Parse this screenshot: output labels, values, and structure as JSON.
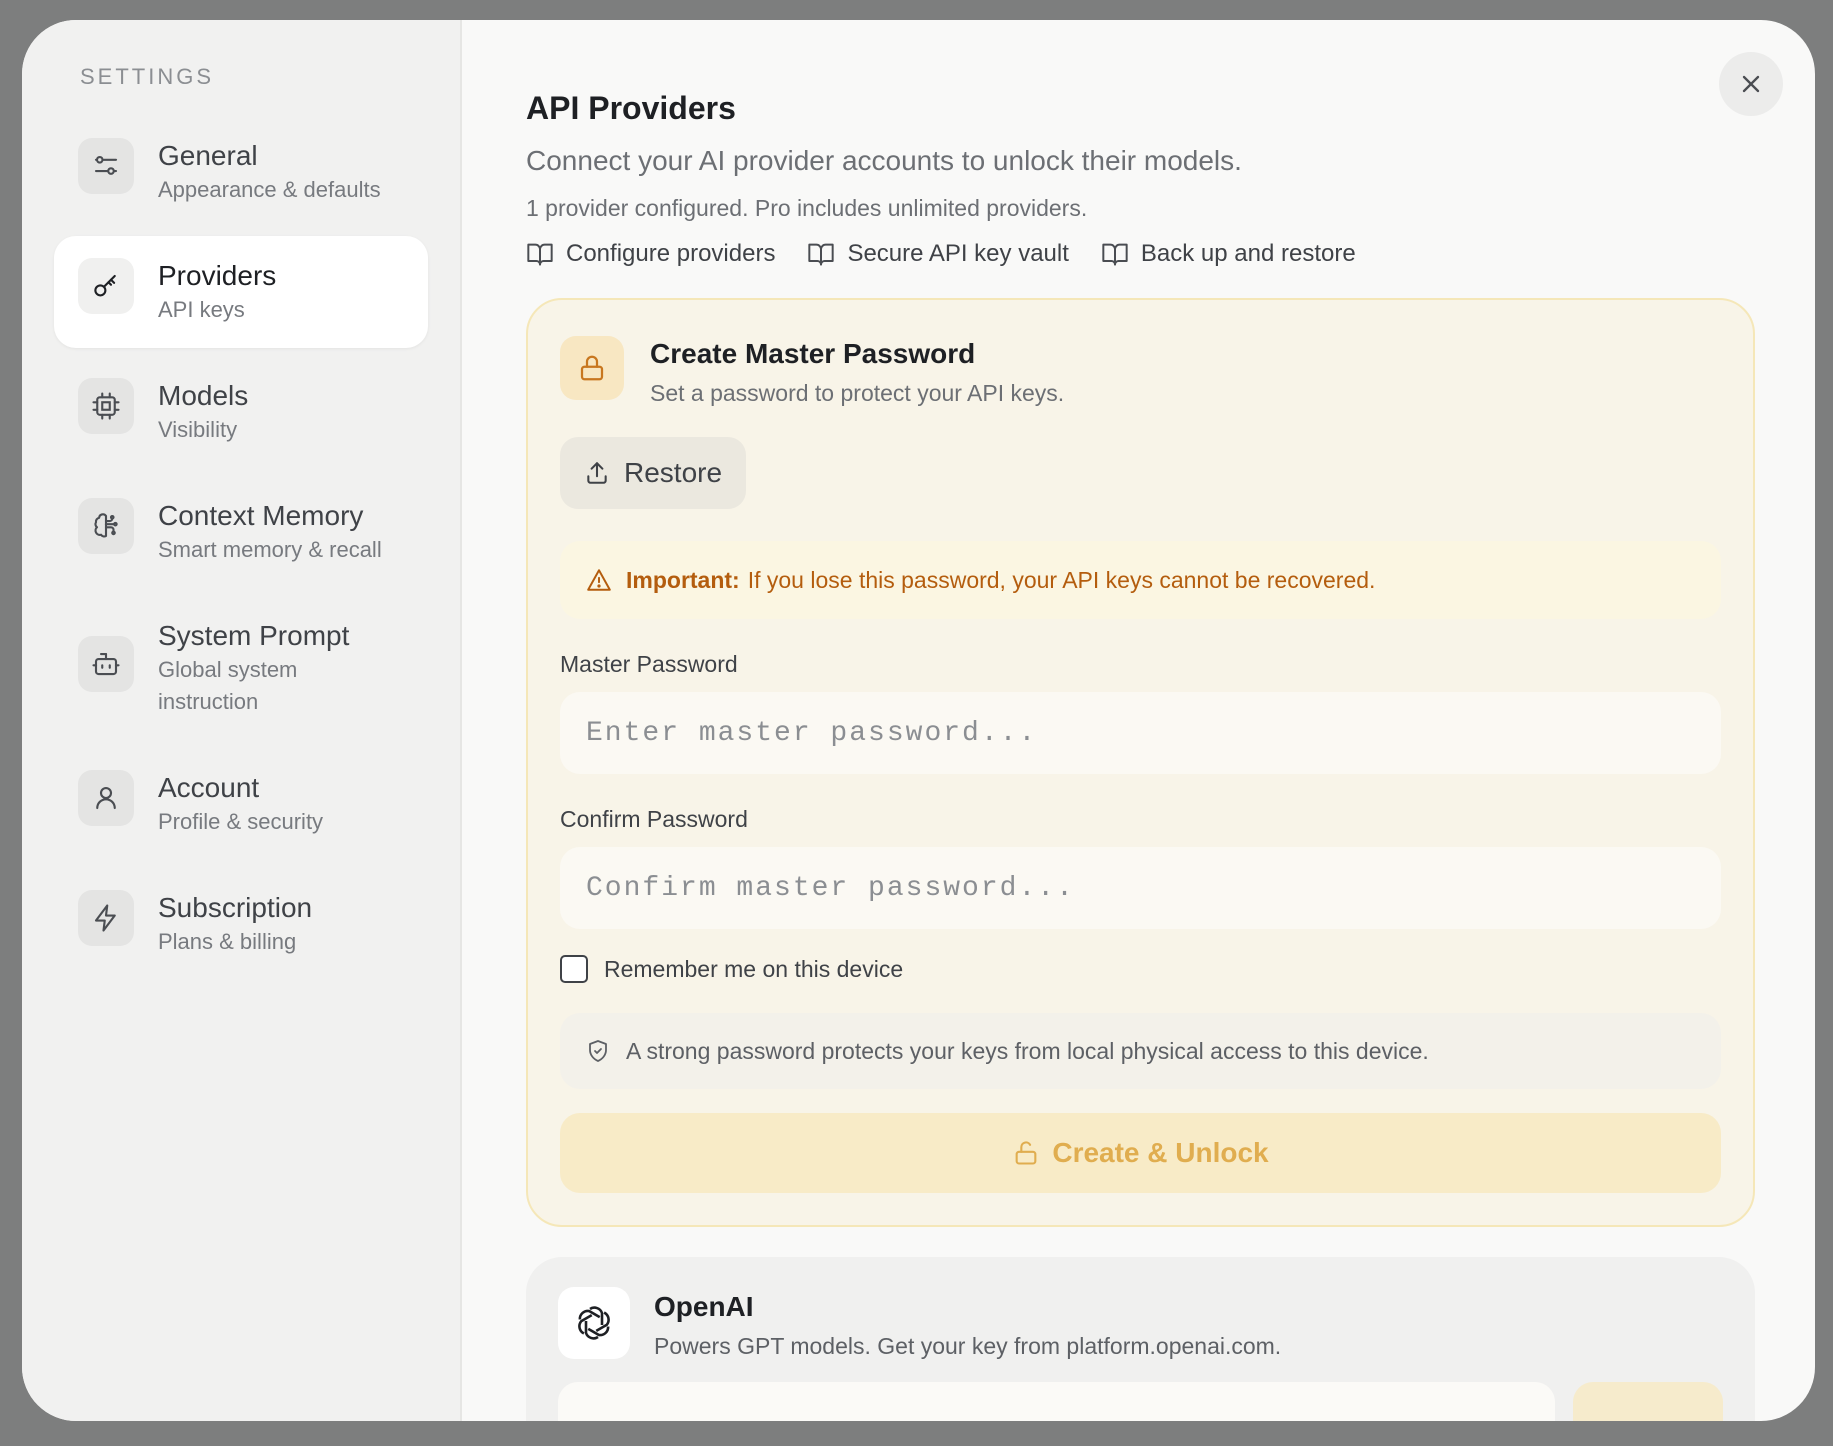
{
  "sidebar": {
    "heading": "SETTINGS",
    "items": [
      {
        "title": "General",
        "subtitle": "Appearance & defaults",
        "icon": "sliders-icon"
      },
      {
        "title": "Providers",
        "subtitle": "API keys",
        "icon": "key-icon",
        "active": true
      },
      {
        "title": "Models",
        "subtitle": "Visibility",
        "icon": "cpu-icon"
      },
      {
        "title": "Context Memory",
        "subtitle": "Smart memory & recall",
        "icon": "brain-icon"
      },
      {
        "title": "System Prompt",
        "subtitle": "Global system instruction",
        "icon": "bot-icon"
      },
      {
        "title": "Account",
        "subtitle": "Profile & security",
        "icon": "user-icon"
      },
      {
        "title": "Subscription",
        "subtitle": "Plans & billing",
        "icon": "bolt-icon"
      }
    ]
  },
  "main": {
    "title": "API Providers",
    "subtitle": "Connect your AI provider accounts to unlock their models.",
    "meta": "1 provider configured. Pro includes unlimited providers.",
    "links": [
      {
        "label": "Configure providers",
        "icon": "book-icon"
      },
      {
        "label": "Secure API key vault",
        "icon": "book-icon"
      },
      {
        "label": "Back up and restore",
        "icon": "book-icon"
      }
    ]
  },
  "master_password": {
    "title": "Create Master Password",
    "subtitle": "Set a password to protect your API keys.",
    "restore_label": "Restore",
    "warning_strong": "Important:",
    "warning_text": "If you lose this password, your API keys cannot be recovered.",
    "password_label": "Master Password",
    "password_placeholder": "Enter master password...",
    "confirm_label": "Confirm Password",
    "confirm_placeholder": "Confirm master password...",
    "remember_label": "Remember me on this device",
    "remember_checked": false,
    "note": "A strong password protects your keys from local physical access to this device.",
    "submit_label": "Create & Unlock"
  },
  "provider": {
    "name": "OpenAI",
    "description": "Powers GPT models. Get your key from platform.openai.com."
  },
  "colors": {
    "accent": "#c8771f",
    "warning_text": "#b45d0e",
    "card_bg": "#f8f4e8",
    "card_border": "#f5e7b8"
  }
}
